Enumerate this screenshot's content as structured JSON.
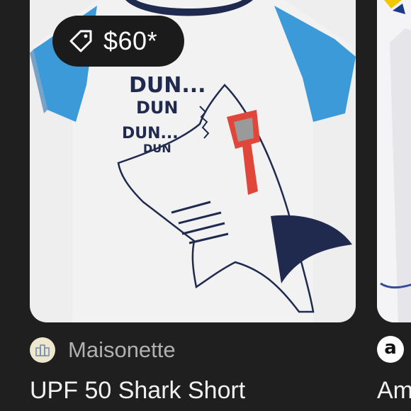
{
  "results": [
    {
      "price": "$60*",
      "price_icon": "tag-icon",
      "source": "Maisonette",
      "source_icon": "maisonette-favicon",
      "title": "UPF 50 Shark Short",
      "image": {
        "shirt_body_color": "#f2f2f2",
        "sleeve_color": "#3d9ad8",
        "collar_color": "#1f2a4e",
        "print_text": [
          "DUN...",
          "DUN",
          "DUN...",
          "DUN"
        ],
        "sunglasses_color": "#e0463a"
      }
    },
    {
      "source_icon": "amazon-logo",
      "title": "Am"
    }
  ]
}
